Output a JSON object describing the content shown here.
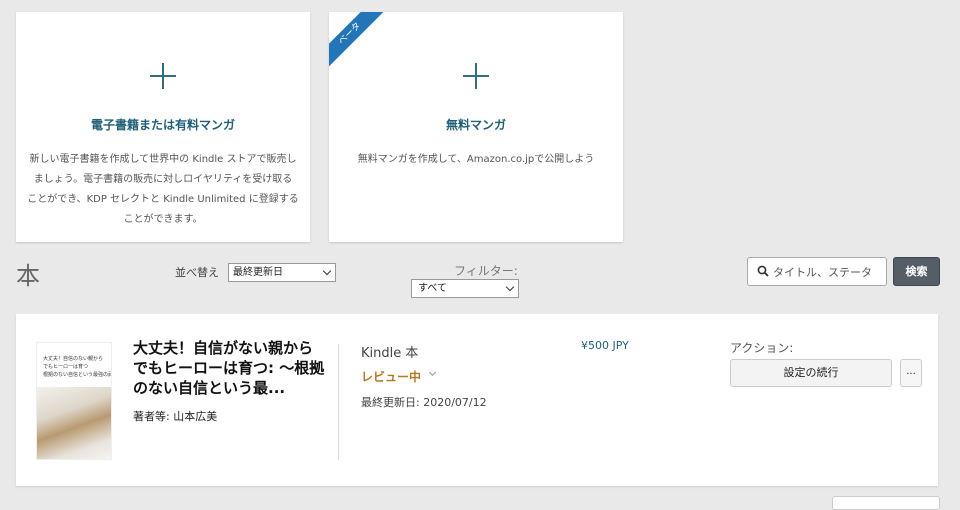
{
  "create_cards": [
    {
      "title": "電子書籍または有料マンガ",
      "desc_lines": [
        "新しい電子書籍を作成して世界中の Kindle ストアで販売し",
        "ましょう。電子書籍の販売に対しロイヤリティを受け取る",
        "ことができ、KDP セレクトと Kindle Unlimited に登録する",
        "ことができます。"
      ]
    },
    {
      "ribbon": "ベータ",
      "title": "無料マンガ",
      "desc_lines": [
        "無料マンガを作成して、Amazon.co.jpで公開しよう"
      ]
    }
  ],
  "section_title": "本",
  "controls": {
    "sort_label": "並べ替え",
    "sort_value": "最終更新日",
    "filter_label": "フィルター:",
    "filter_value": "すべて",
    "search_placeholder": "タイトル、ステータ",
    "search_button": "検索"
  },
  "book": {
    "cover_lines": [
      "大丈夫！自信のない親から",
      "でもヒーローは育つ",
      "根拠のない自信という最強の武器"
    ],
    "title_lines": [
      "大丈夫！自信がない親から",
      "でもヒーローは育つ: 〜根拠",
      "のない自信という最..."
    ],
    "author": "著者等: 山本広美",
    "format": "Kindle 本",
    "status": "レビュー中",
    "updated": "最終更新日: 2020/07/12",
    "price": "¥500 JPY",
    "actions_label": "アクション:",
    "continue_label": "設定の続行",
    "more_label": "..."
  },
  "colors": {
    "accent": "#1f5f78",
    "status": "#b7791f",
    "ribbon": "#2275b8"
  }
}
